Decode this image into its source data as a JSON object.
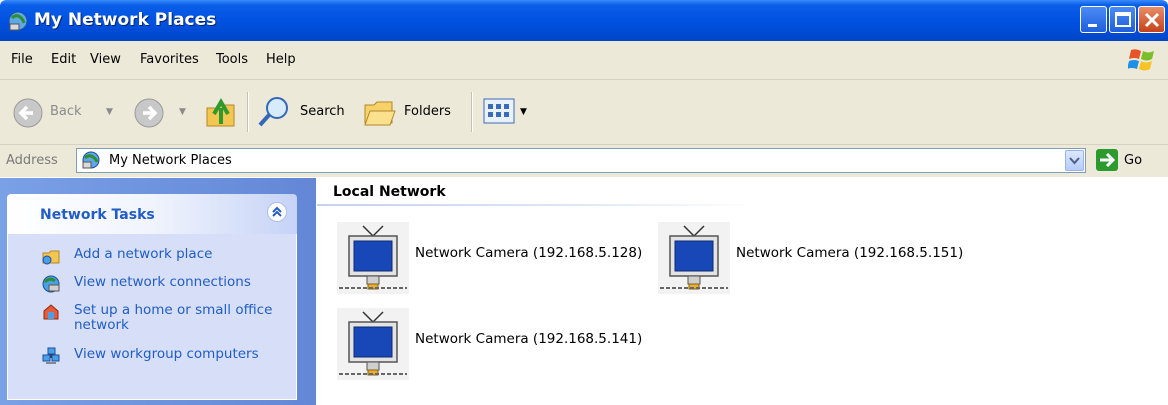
{
  "window": {
    "title": "My Network Places",
    "colors": {
      "titlebar": "#0050e0",
      "close_button": "#c5421a",
      "chrome": "#ece9d8"
    }
  },
  "menu": {
    "items": [
      "File",
      "Edit",
      "View",
      "Favorites",
      "Tools",
      "Help"
    ]
  },
  "toolbar": {
    "back_label": "Back",
    "search_label": "Search",
    "folders_label": "Folders",
    "icons": [
      "back-arrow-icon",
      "forward-arrow-icon",
      "up-folder-icon",
      "search-icon",
      "folders-icon",
      "views-icon"
    ]
  },
  "address": {
    "label": "Address",
    "value": "My Network Places",
    "go_label": "Go"
  },
  "tasks": {
    "title": "Network Tasks",
    "items": [
      {
        "label": "Add a network place",
        "icon": "add-network-place-icon"
      },
      {
        "label": "View network connections",
        "icon": "network-connections-icon"
      },
      {
        "label": "Set up a home or small office network",
        "icon": "home-network-setup-icon"
      },
      {
        "label": "View workgroup computers",
        "icon": "workgroup-computers-icon"
      }
    ]
  },
  "content": {
    "group_title": "Local Network",
    "items": [
      {
        "label": "Network Camera (192.168.5.128)"
      },
      {
        "label": "Network Camera (192.168.5.151)"
      },
      {
        "label": "Network Camera (192.168.5.141)"
      }
    ]
  }
}
